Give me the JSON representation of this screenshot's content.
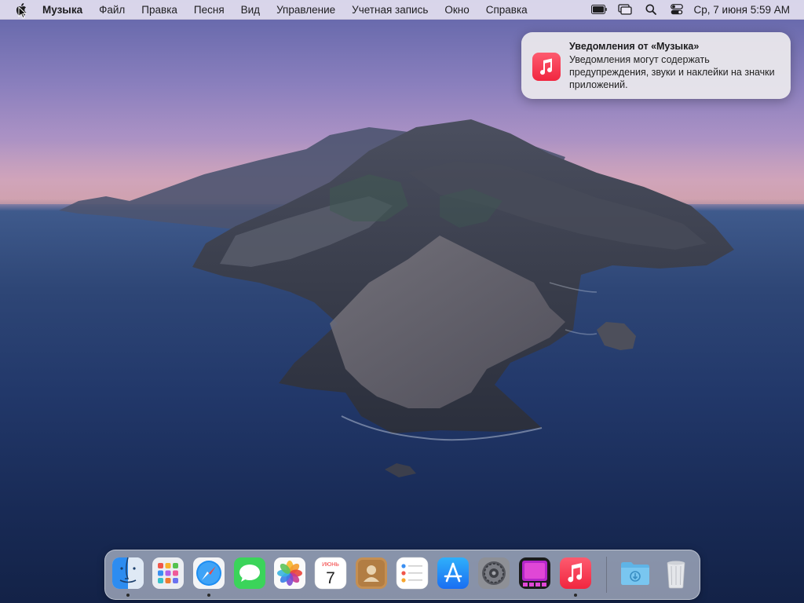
{
  "menubar": {
    "app_name": "Музыка",
    "items": [
      "Файл",
      "Правка",
      "Песня",
      "Вид",
      "Управление",
      "Учетная запись",
      "Окно",
      "Справка"
    ],
    "status_icons": [
      "battery-icon",
      "screen-mirroring-icon",
      "spotlight-search-icon",
      "control-center-icon"
    ],
    "clock": "Ср, 7 июня  5:59 AM"
  },
  "notification": {
    "app_icon": "music-app-icon",
    "title": "Уведомления от «Музыка»",
    "body": "Уведомления могут содержать предупреждения, звуки и наклейки на значки приложений."
  },
  "dock": {
    "items": [
      {
        "name": "finder",
        "running": true
      },
      {
        "name": "launchpad",
        "running": false
      },
      {
        "name": "safari",
        "running": true
      },
      {
        "name": "messages",
        "running": false
      },
      {
        "name": "photos",
        "running": false
      },
      {
        "name": "calendar",
        "running": false,
        "month": "ИЮНЬ",
        "day": "7"
      },
      {
        "name": "contacts",
        "running": false
      },
      {
        "name": "reminders",
        "running": false
      },
      {
        "name": "app-store",
        "running": false
      },
      {
        "name": "system-preferences",
        "running": false
      },
      {
        "name": "photo-booth",
        "running": false
      },
      {
        "name": "music",
        "running": true
      },
      {
        "name": "downloads-folder",
        "running": false
      },
      {
        "name": "trash",
        "running": false
      }
    ]
  },
  "colors": {
    "music_red": "#fa2d48",
    "menubar_bg": "#ece8f5",
    "notification_bg": "#e8e6eb"
  }
}
